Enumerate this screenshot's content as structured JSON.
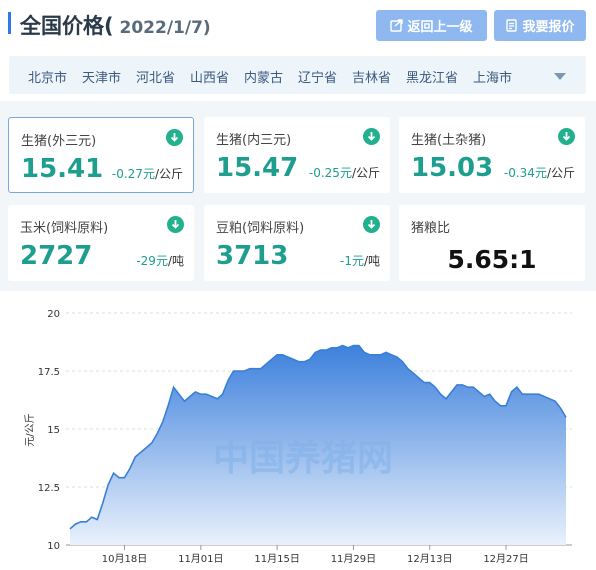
{
  "header": {
    "title": "全国价格(",
    "date": " 2022/1/7)",
    "back_label": "返回上一级",
    "report_label": "我要报价",
    "accent": "#2e7be8"
  },
  "regions": [
    "北京市",
    "天津市",
    "河北省",
    "山西省",
    "内蒙古",
    "辽宁省",
    "吉林省",
    "黑龙江省",
    "上海市"
  ],
  "cards": [
    {
      "name": "生猪(外三元)",
      "value": "15.41",
      "change": "-0.27元",
      "unit": "/公斤",
      "icon": "down-arrow-icon",
      "selected": true
    },
    {
      "name": "生猪(内三元)",
      "value": "15.47",
      "change": "-0.25元",
      "unit": "/公斤",
      "icon": "down-arrow-icon"
    },
    {
      "name": "生猪(土杂猪)",
      "value": "15.03",
      "change": "-0.34元",
      "unit": "/公斤",
      "icon": "down-arrow-icon"
    },
    {
      "name": "玉米(饲料原料)",
      "value": "2727",
      "change": "-29元",
      "unit": "/吨",
      "icon": "down-arrow-icon"
    },
    {
      "name": "豆粕(饲料原料)",
      "value": "3713",
      "change": "-1元",
      "unit": "/吨",
      "icon": "down-arrow-icon"
    },
    {
      "name": "猪粮比",
      "value": "5.65:1"
    }
  ],
  "colors": {
    "value_green": "#1e9e8e",
    "line": "#3a7fd6",
    "area": "#5b9be8"
  },
  "chart_data": {
    "type": "area",
    "title": "",
    "xlabel": "",
    "ylabel": "元/公斤",
    "watermark": "中国养猪网",
    "ylim": [
      10,
      20
    ],
    "yticks": [
      "10",
      "12.5",
      "15",
      "17.5",
      "20"
    ],
    "xticks": [
      "10月18日",
      "11月01日",
      "11月15日",
      "11月29日",
      "12月13日",
      "12月27日"
    ],
    "x": [
      "10-08",
      "10-09",
      "10-10",
      "10-11",
      "10-12",
      "10-13",
      "10-14",
      "10-15",
      "10-16",
      "10-17",
      "10-18",
      "10-19",
      "10-20",
      "10-21",
      "10-22",
      "10-23",
      "10-24",
      "10-25",
      "10-26",
      "10-27",
      "10-28",
      "10-29",
      "10-30",
      "10-31",
      "11-01",
      "11-02",
      "11-03",
      "11-04",
      "11-05",
      "11-06",
      "11-07",
      "11-08",
      "11-09",
      "11-10",
      "11-11",
      "11-12",
      "11-13",
      "11-14",
      "11-15",
      "11-16",
      "11-17",
      "11-18",
      "11-19",
      "11-20",
      "11-21",
      "11-22",
      "11-23",
      "11-24",
      "11-25",
      "11-26",
      "11-27",
      "11-28",
      "11-29",
      "11-30",
      "12-01",
      "12-02",
      "12-03",
      "12-04",
      "12-05",
      "12-06",
      "12-07",
      "12-08",
      "12-09",
      "12-10",
      "12-11",
      "12-12",
      "12-13",
      "12-14",
      "12-15",
      "12-16",
      "12-17",
      "12-18",
      "12-19",
      "12-20",
      "12-21",
      "12-22",
      "12-23",
      "12-24",
      "12-25",
      "12-26",
      "12-27",
      "12-28",
      "12-29",
      "12-30",
      "12-31",
      "01-01",
      "01-02",
      "01-03",
      "01-04",
      "01-05",
      "01-06",
      "01-07"
    ],
    "values": [
      10.7,
      10.9,
      11.0,
      11.0,
      11.2,
      11.1,
      11.8,
      12.6,
      13.1,
      12.9,
      12.9,
      13.3,
      13.8,
      14.0,
      14.2,
      14.4,
      14.8,
      15.3,
      16.0,
      16.8,
      16.5,
      16.2,
      16.4,
      16.6,
      16.5,
      16.5,
      16.4,
      16.3,
      16.5,
      17.1,
      17.5,
      17.5,
      17.5,
      17.6,
      17.6,
      17.6,
      17.8,
      18.0,
      18.2,
      18.2,
      18.1,
      18.0,
      17.9,
      17.9,
      18.0,
      18.3,
      18.4,
      18.4,
      18.5,
      18.5,
      18.6,
      18.5,
      18.6,
      18.6,
      18.3,
      18.2,
      18.2,
      18.2,
      18.3,
      18.2,
      18.1,
      17.9,
      17.6,
      17.4,
      17.2,
      17.0,
      17.0,
      16.8,
      16.5,
      16.3,
      16.6,
      16.9,
      16.9,
      16.8,
      16.8,
      16.6,
      16.4,
      16.5,
      16.2,
      16.0,
      16.0,
      16.6,
      16.8,
      16.5,
      16.5,
      16.5,
      16.5,
      16.4,
      16.3,
      16.2,
      15.9,
      15.5
    ]
  }
}
